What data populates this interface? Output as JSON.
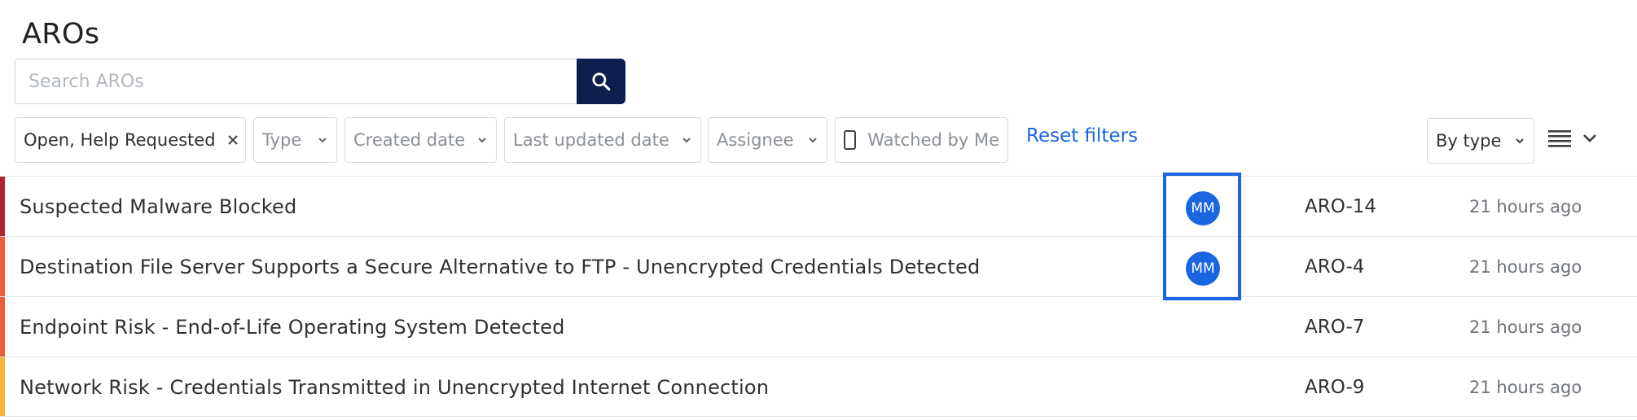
{
  "page": {
    "title": "AROs"
  },
  "search": {
    "placeholder": "Search AROs",
    "value": ""
  },
  "filters": {
    "status": {
      "label": "Open, Help Requested"
    },
    "type": {
      "label": "Type"
    },
    "created": {
      "label": "Created date"
    },
    "updated": {
      "label": "Last updated date"
    },
    "assignee": {
      "label": "Assignee"
    },
    "watched": {
      "label": "Watched by Me",
      "checked": false
    },
    "reset_label": "Reset filters"
  },
  "grouping": {
    "label": "By type"
  },
  "rows": [
    {
      "title": "Suspected Malware Blocked",
      "assignee": "MM",
      "id": "ARO-14",
      "time": "21 hours ago",
      "severity_color": "#b0232a"
    },
    {
      "title": "Destination File Server Supports a Secure Alternative to FTP - Unencrypted Credentials Detected",
      "assignee": "MM",
      "id": "ARO-4",
      "time": "21 hours ago",
      "severity_color": "#ef5b3c"
    },
    {
      "title": "Endpoint Risk - End-of-Life Operating System Detected",
      "assignee": "",
      "id": "ARO-7",
      "time": "21 hours ago",
      "severity_color": "#ef5b3c"
    },
    {
      "title": "Network Risk - Credentials Transmitted in Unencrypted Internet Connection",
      "assignee": "",
      "id": "ARO-9",
      "time": "21 hours ago",
      "severity_color": "#f2b53a"
    }
  ],
  "colors": {
    "accent": "#1a66e0",
    "search_button": "#0c1f4e"
  }
}
